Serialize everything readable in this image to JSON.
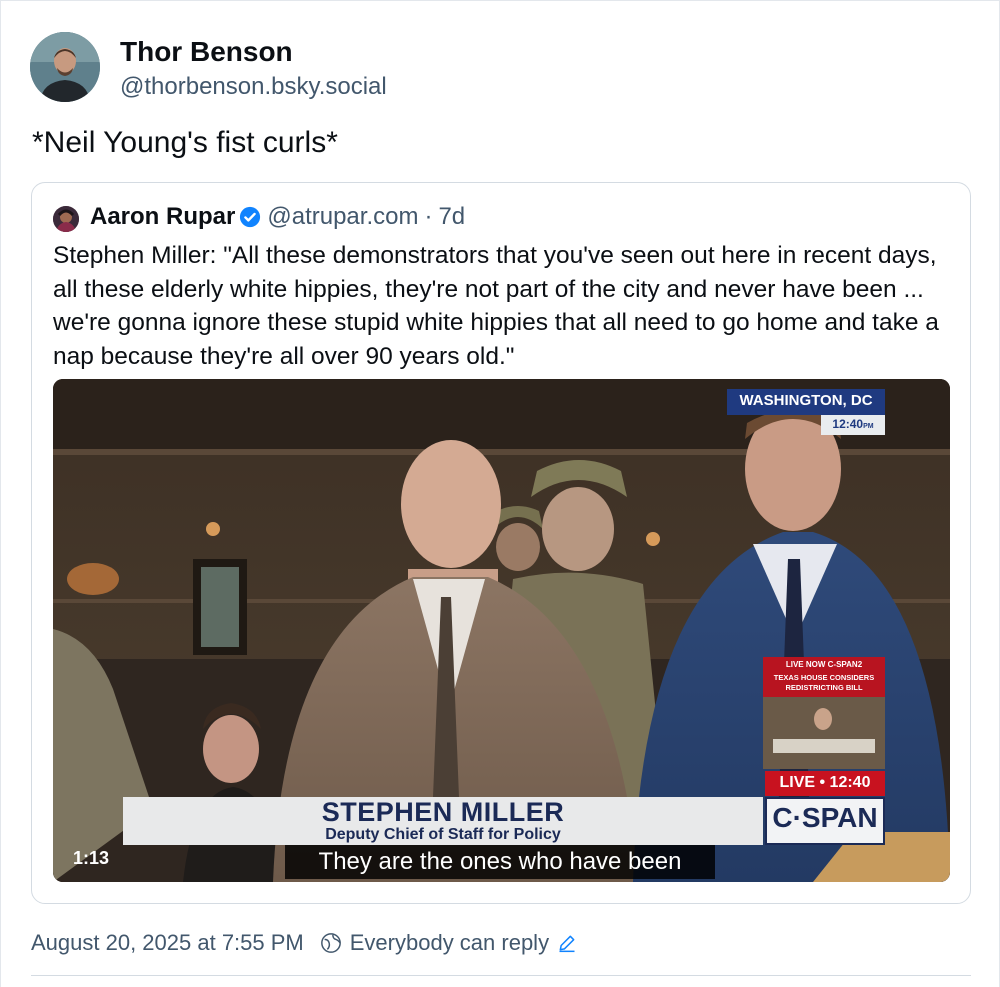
{
  "post": {
    "author_name": "Thor Benson",
    "author_handle": "@thorbenson.bsky.social",
    "text": "*Neil Young's fist curls*",
    "timestamp": "August 20, 2025 at 7:55 PM",
    "reply_setting": "Everybody can reply"
  },
  "quote": {
    "author_name": "Aaron Rupar",
    "author_handle": "@atrupar.com",
    "separator": "·",
    "age": "7d",
    "text": "Stephen Miller: \"All these demonstrators that you've seen out here in recent days, all these elderly white hippies, they're not part of the city and never have been ... we're gonna ignore these stupid white hippies that all need to go home and take a nap because they're all over 90 years old.\""
  },
  "video": {
    "duration": "1:13",
    "caption": "They are the ones who have been",
    "chyron_name": "STEPHEN MILLER",
    "chyron_title": "Deputy Chief of Staff for Policy",
    "location": "WASHINGTON, DC",
    "location_time": "12:40",
    "location_time_suffix": "PM",
    "network": "C·SPAN",
    "live_label": "LIVE • 12:40",
    "pip_header": "LIVE NOW C-SPAN2",
    "pip_line1": "TEXAS HOUSE CONSIDERS",
    "pip_line2": "REDISTRICTING BILL"
  },
  "icons": {
    "verified": "verified-badge-icon",
    "globe": "globe-icon",
    "edit": "pencil-icon"
  },
  "colors": {
    "accent": "#1083fe",
    "muted_text": "#42576c",
    "border": "#d4dbe2"
  }
}
